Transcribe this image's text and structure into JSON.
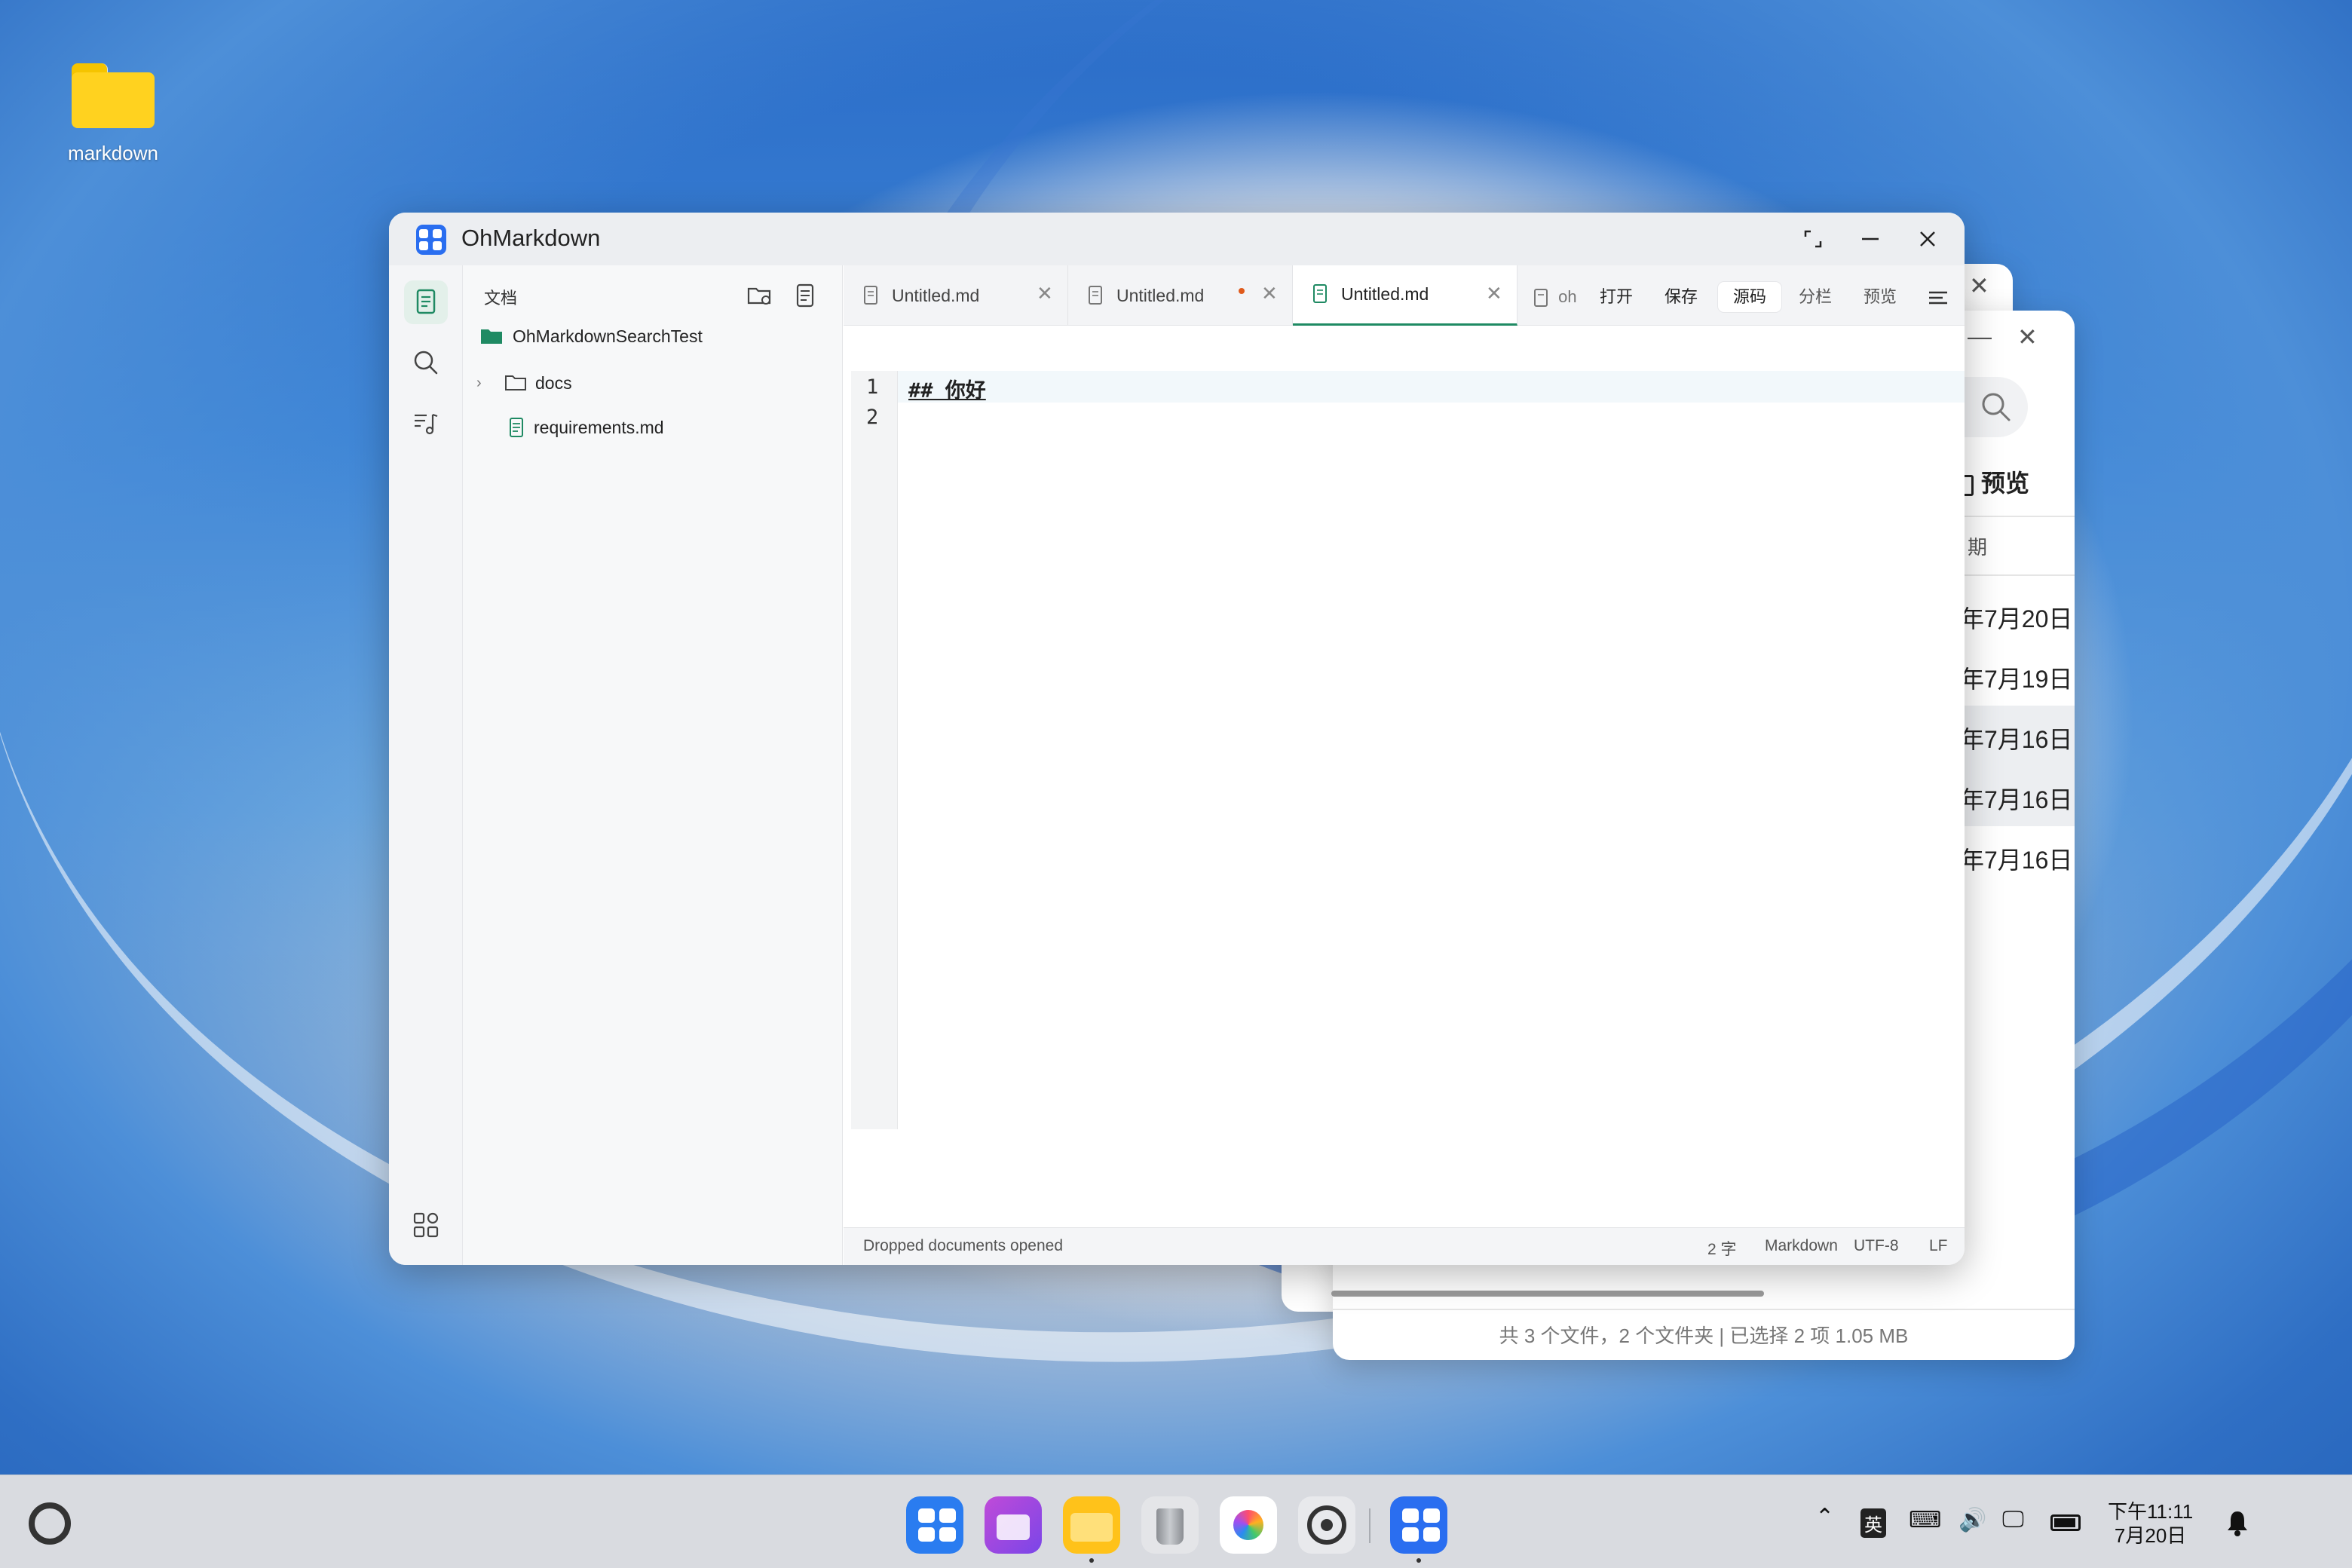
{
  "desktop": {
    "folder_label": "markdown"
  },
  "background_window": {
    "preview_label": "预览",
    "column_header": "期",
    "dates": [
      "年7月20日",
      "年7月19日",
      "年7月16日",
      "年7月16日",
      "年7月16日"
    ],
    "status": "共 3 个文件，2 个文件夹 | 已选择 2 项  1.05 MB"
  },
  "window": {
    "title": "OhMarkdown"
  },
  "explorer": {
    "header": "文档",
    "root": "OhMarkdownSearchTest",
    "items": [
      {
        "name": "docs",
        "type": "folder"
      },
      {
        "name": "requirements.md",
        "type": "file"
      }
    ]
  },
  "tabs": [
    {
      "label": "Untitled.md",
      "modified": false,
      "active": false
    },
    {
      "label": "Untitled.md",
      "modified": true,
      "active": false
    },
    {
      "label": "Untitled.md",
      "modified": false,
      "active": true
    }
  ],
  "toolbar": {
    "file_fragment": "oh",
    "open": "打开",
    "save": "保存",
    "source": "源码",
    "split": "分栏",
    "preview": "预览"
  },
  "editor": {
    "line_numbers": [
      "1",
      "2"
    ],
    "line1": "## 你好"
  },
  "statusbar": {
    "message": "Dropped documents opened",
    "word_count": "2 字",
    "language": "Markdown",
    "encoding": "UTF-8",
    "eol": "LF"
  },
  "taskbar": {
    "ime": "英",
    "time": "下午11:11",
    "date": "7月20日"
  },
  "colors": {
    "accent": "#1f8a63",
    "logo_blue": "#2a6ef0",
    "modified_dot": "#e05a1b"
  }
}
